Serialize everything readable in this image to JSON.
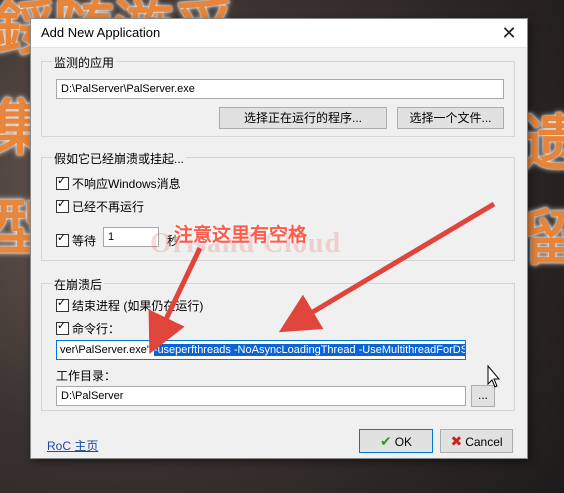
{
  "window": {
    "title": "Add New Application",
    "close_glyph": "✕"
  },
  "monitored": {
    "legend": "监测的应用",
    "path": "D:\\PalServer\\PalServer.exe",
    "btn_running": "选择正在运行的程序...",
    "btn_file": "选择一个文件..."
  },
  "crash_assume": {
    "legend": "假如它已经崩溃或挂起...",
    "opt_not_responding": "不响应Windows消息",
    "opt_not_running": "已经不再运行",
    "wait_label": "等待",
    "wait_value": "1",
    "wait_unit": "秒"
  },
  "after_crash": {
    "legend": "在崩溃后",
    "opt_kill": "结束进程 (如果仍在运行)",
    "opt_command": "命令行：",
    "command_plain": "ver\\PalServer.exe\" ",
    "command_selected": "-useperfthreads -NoAsyncLoadingThread -UseMultithreadForDS",
    "workdir_label": "工作目录：",
    "workdir_value": "D:\\PalServer",
    "browse_label": "..."
  },
  "footer": {
    "link": "RoC 主页",
    "ok_label": "OK",
    "cancel_label": "Cancel",
    "ok_icon": "check-icon",
    "cancel_icon": "x-icon"
  },
  "overlay": {
    "annotation": "注意这里有空格",
    "watermark": "Orisand Cloud",
    "arrow_color": "#e0453c"
  },
  "background": {
    "glyph_1": "鋖随湤舀",
    "glyph_2": "集",
    "glyph_3": "型",
    "glyph_4": "遗",
    "glyph_5": "留"
  }
}
